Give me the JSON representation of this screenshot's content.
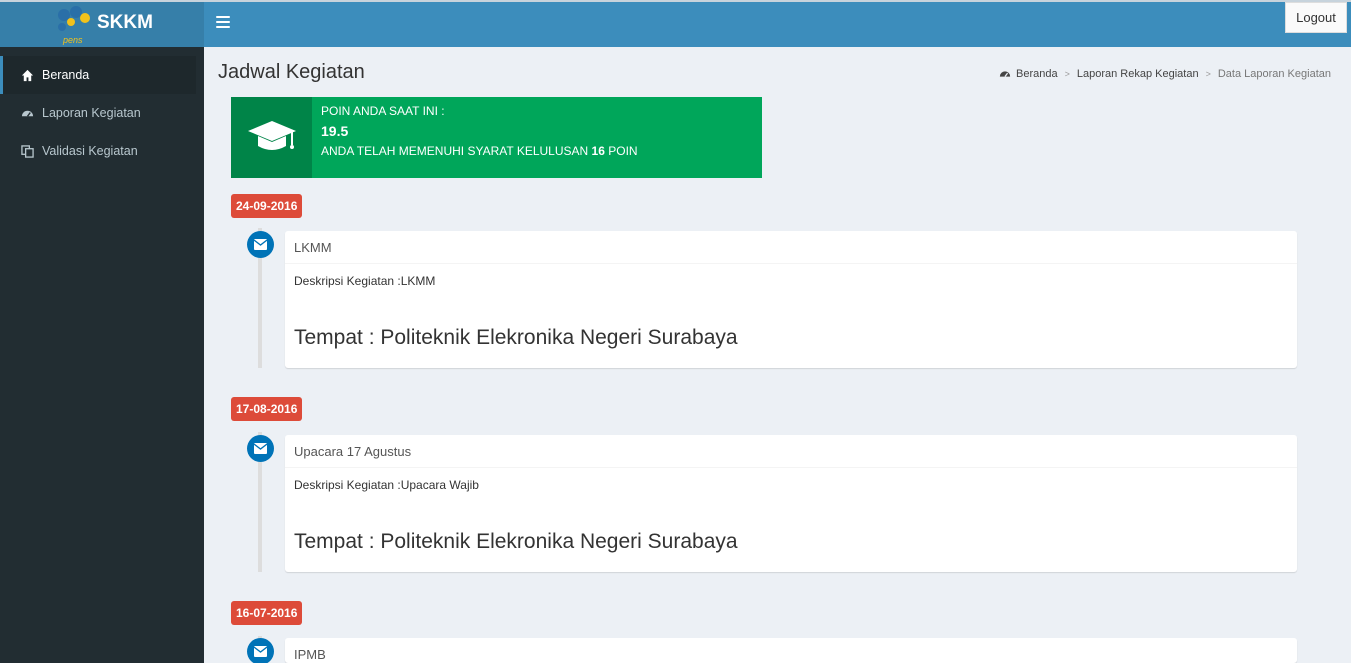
{
  "app": {
    "logo_text": "SKKM",
    "logo_subtext": "pens"
  },
  "topbar": {
    "logout_label": "Logout"
  },
  "sidebar": {
    "items": [
      {
        "label": "Beranda",
        "icon": "home-icon",
        "active": true
      },
      {
        "label": "Laporan Kegiatan",
        "icon": "dashboard-icon",
        "active": false
      },
      {
        "label": "Validasi Kegiatan",
        "icon": "copy-icon",
        "active": false
      }
    ]
  },
  "page": {
    "title": "Jadwal Kegiatan"
  },
  "breadcrumb": {
    "items": [
      "Beranda",
      "Laporan Rekap Kegiatan",
      "Data Laporan Kegiatan"
    ],
    "separator": ">"
  },
  "info_box": {
    "line1": "POIN ANDA SAAT INI :",
    "value": "19.5",
    "line3_prefix": "ANDA TELAH MEMENUHI SYARAT KELULUSAN",
    "line3_number": "16",
    "line3_suffix": "POIN",
    "icon": "graduation-cap-icon",
    "color": "#00a65a"
  },
  "timeline": [
    {
      "date": "24-09-2016",
      "title": "LKMM",
      "desc": "Deskripsi Kegiatan :LKMM",
      "place": "Tempat : Politeknik Elekronika Negeri Surabaya"
    },
    {
      "date": "17-08-2016",
      "title": "Upacara 17 Agustus",
      "desc": "Deskripsi Kegiatan :Upacara Wajib",
      "place": "Tempat : Politeknik Elekronika Negeri Surabaya"
    },
    {
      "date": "16-07-2016",
      "title": "IPMB",
      "desc": "",
      "place": ""
    }
  ],
  "colors": {
    "topbar": "#3c8dbc",
    "sidebar": "#222d32",
    "date_badge": "#dd4b39",
    "timeline_icon": "#0073b7"
  }
}
